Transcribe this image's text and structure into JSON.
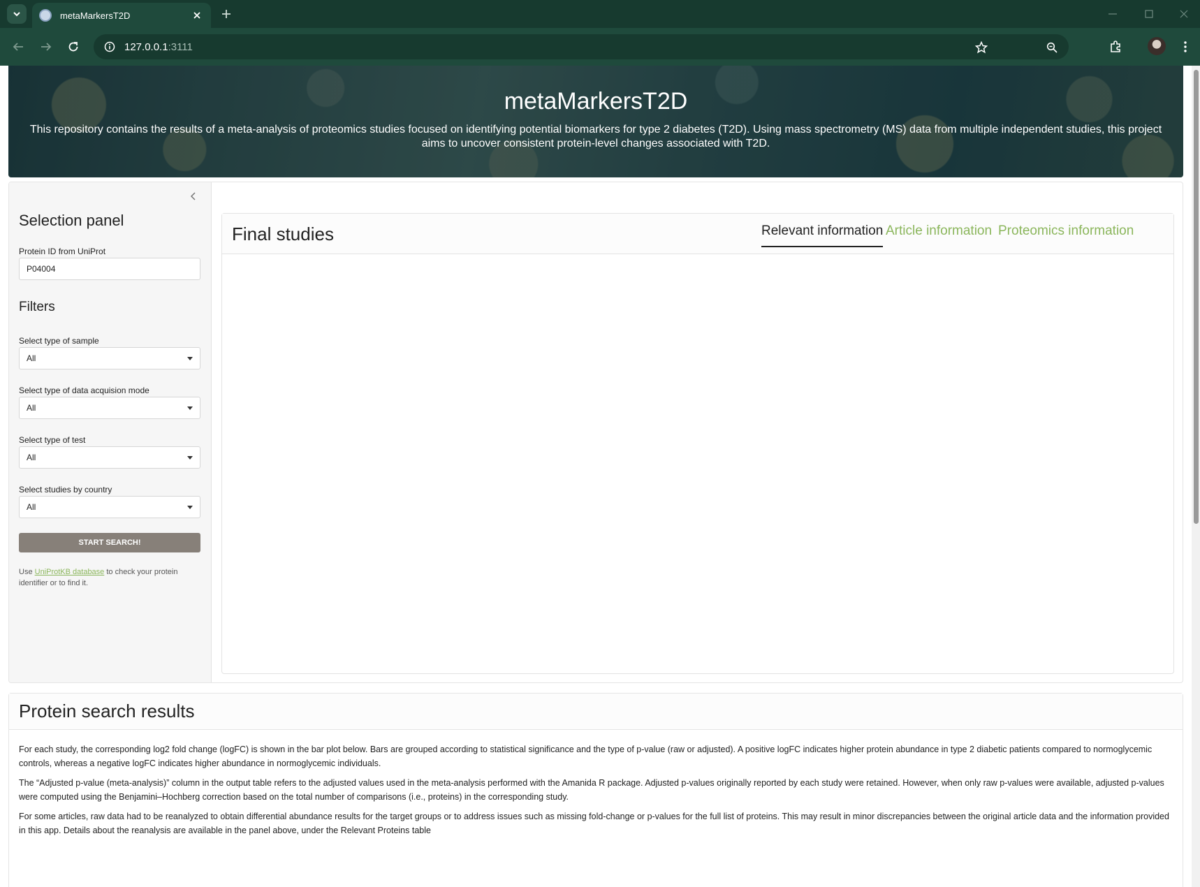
{
  "browser": {
    "tab_title": "metaMarkersT2D",
    "url_host": "127.0.0.1",
    "url_port": ":3111"
  },
  "banner": {
    "title": "metaMarkersT2D",
    "description": "This repository contains the results of a meta-analysis of proteomics studies focused on identifying potential biomarkers for type 2 diabetes (T2D). Using mass spectrometry (MS) data from multiple independent studies, this project aims to uncover consistent protein-level changes associated with T2D."
  },
  "sidebar": {
    "title": "Selection panel",
    "protein_label": "Protein ID from UniProt",
    "protein_value": "P04004",
    "filters_title": "Filters",
    "filters": [
      {
        "label": "Select type of sample",
        "value": "All"
      },
      {
        "label": "Select type of data acquision mode",
        "value": "All"
      },
      {
        "label": "Select type of test",
        "value": "All"
      },
      {
        "label": "Select studies by country",
        "value": "All"
      }
    ],
    "search_button": "START SEARCH!",
    "note_prefix": "Use ",
    "note_link": "UniProtKB database",
    "note_suffix": " to check your protein identifier or to find it."
  },
  "studies": {
    "title": "Final studies",
    "tabs": [
      {
        "label": "Relevant information",
        "active": true
      },
      {
        "label": "Article information",
        "active": false
      },
      {
        "label": "Proteomics information",
        "active": false
      }
    ]
  },
  "results": {
    "title": "Protein search results",
    "paragraphs": [
      "For each study, the corresponding log2 fold change (logFC) is shown in the bar plot below. Bars are grouped according to statistical significance and the type of p-value (raw or adjusted). A positive logFC indicates higher protein abundance in type 2 diabetic patients compared to normoglycemic controls, whereas a negative logFC indicates higher abundance in normoglycemic individuals.",
      "The “Adjusted p-value (meta-analysis)” column in the output table refers to the adjusted values used in the meta-analysis performed with the Amanida R package. Adjusted p-values originally reported by each study were retained. However, when only raw p-values were available, adjusted p-values were computed using the Benjamini–Hochberg correction based on the total number of comparisons (i.e., proteins) in the corresponding study.",
      "For some articles, raw data had to be reanalyzed to obtain differential abundance results for the target groups or to address issues such as missing fold-change or p-values for the full list of proteins. This may result in minor discrepancies between the original article data and the information provided in this app. Details about the reanalysis are available in the panel above, under the Relevant Proteins table"
    ]
  },
  "colors": {
    "accent_green": "#8bb65c",
    "browser_frame": "#1f4a3c",
    "button_gray": "#878079"
  },
  "icons": [
    "tab-search-icon",
    "favicon-icon",
    "close-icon",
    "plus-icon",
    "minimize-icon",
    "maximize-icon",
    "window-close-icon",
    "back-icon",
    "forward-icon",
    "reload-icon",
    "site-info-icon",
    "zoom-icon",
    "star-icon",
    "extensions-icon",
    "kebab-menu-icon",
    "chevron-left-icon",
    "chevron-down-icon"
  ]
}
